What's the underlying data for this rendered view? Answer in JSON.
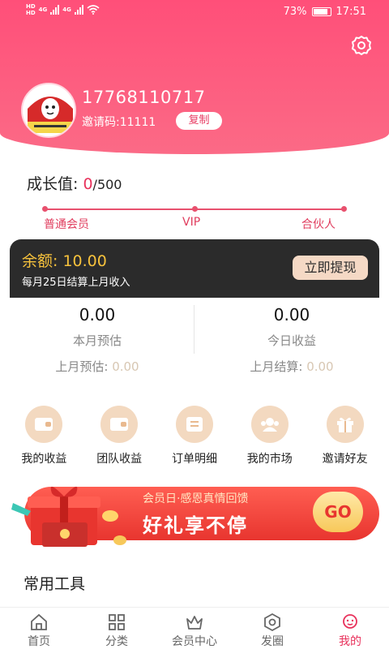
{
  "status_bar": {
    "hd1": "HD",
    "hd2": "HD",
    "net1": "4G",
    "net2": "4G",
    "battery": "73%",
    "time": "17:51"
  },
  "profile": {
    "phone": "17768110717",
    "invite_label": "邀请码:",
    "invite_code": "11111",
    "copy_label": "复制",
    "avatar_icon": "avatar-icon"
  },
  "growth": {
    "label": "成长值: ",
    "current": "0",
    "max": "/500",
    "levels": [
      "普通会员",
      "VIP",
      "合伙人"
    ]
  },
  "balance": {
    "label": "余额: ",
    "amount": "10.00",
    "note": "每月25日结算上月收入",
    "withdraw_label": "立即提现"
  },
  "earnings": {
    "month_value": "0.00",
    "month_label": "本月预估",
    "last_month_est_label": "上月预估: ",
    "last_month_est_value": "0.00",
    "today_value": "0.00",
    "today_label": "今日收益",
    "last_month_settle_label": "上月结算: ",
    "last_month_settle_value": "0.00"
  },
  "features": [
    {
      "label": "我的收益",
      "icon": "wallet-icon"
    },
    {
      "label": "团队收益",
      "icon": "wallet-icon"
    },
    {
      "label": "订单明细",
      "icon": "list-icon"
    },
    {
      "label": "我的市场",
      "icon": "team-icon"
    },
    {
      "label": "邀请好友",
      "icon": "gift-icon"
    }
  ],
  "banner": {
    "line1": "会员日·感恩真情回馈",
    "line2": "好礼享不停",
    "go": "GO"
  },
  "tools_title": "常用工具",
  "tabs": [
    {
      "label": "首页",
      "icon": "home-icon"
    },
    {
      "label": "分类",
      "icon": "category-icon"
    },
    {
      "label": "会员中心",
      "icon": "crown-icon"
    },
    {
      "label": "发圈",
      "icon": "share-icon"
    },
    {
      "label": "我的",
      "icon": "profile-icon"
    }
  ],
  "colors": {
    "brand": "#ff4f79",
    "accent": "#e8315b",
    "gold": "#f7c23c",
    "dark_card": "#2b2b2b"
  }
}
